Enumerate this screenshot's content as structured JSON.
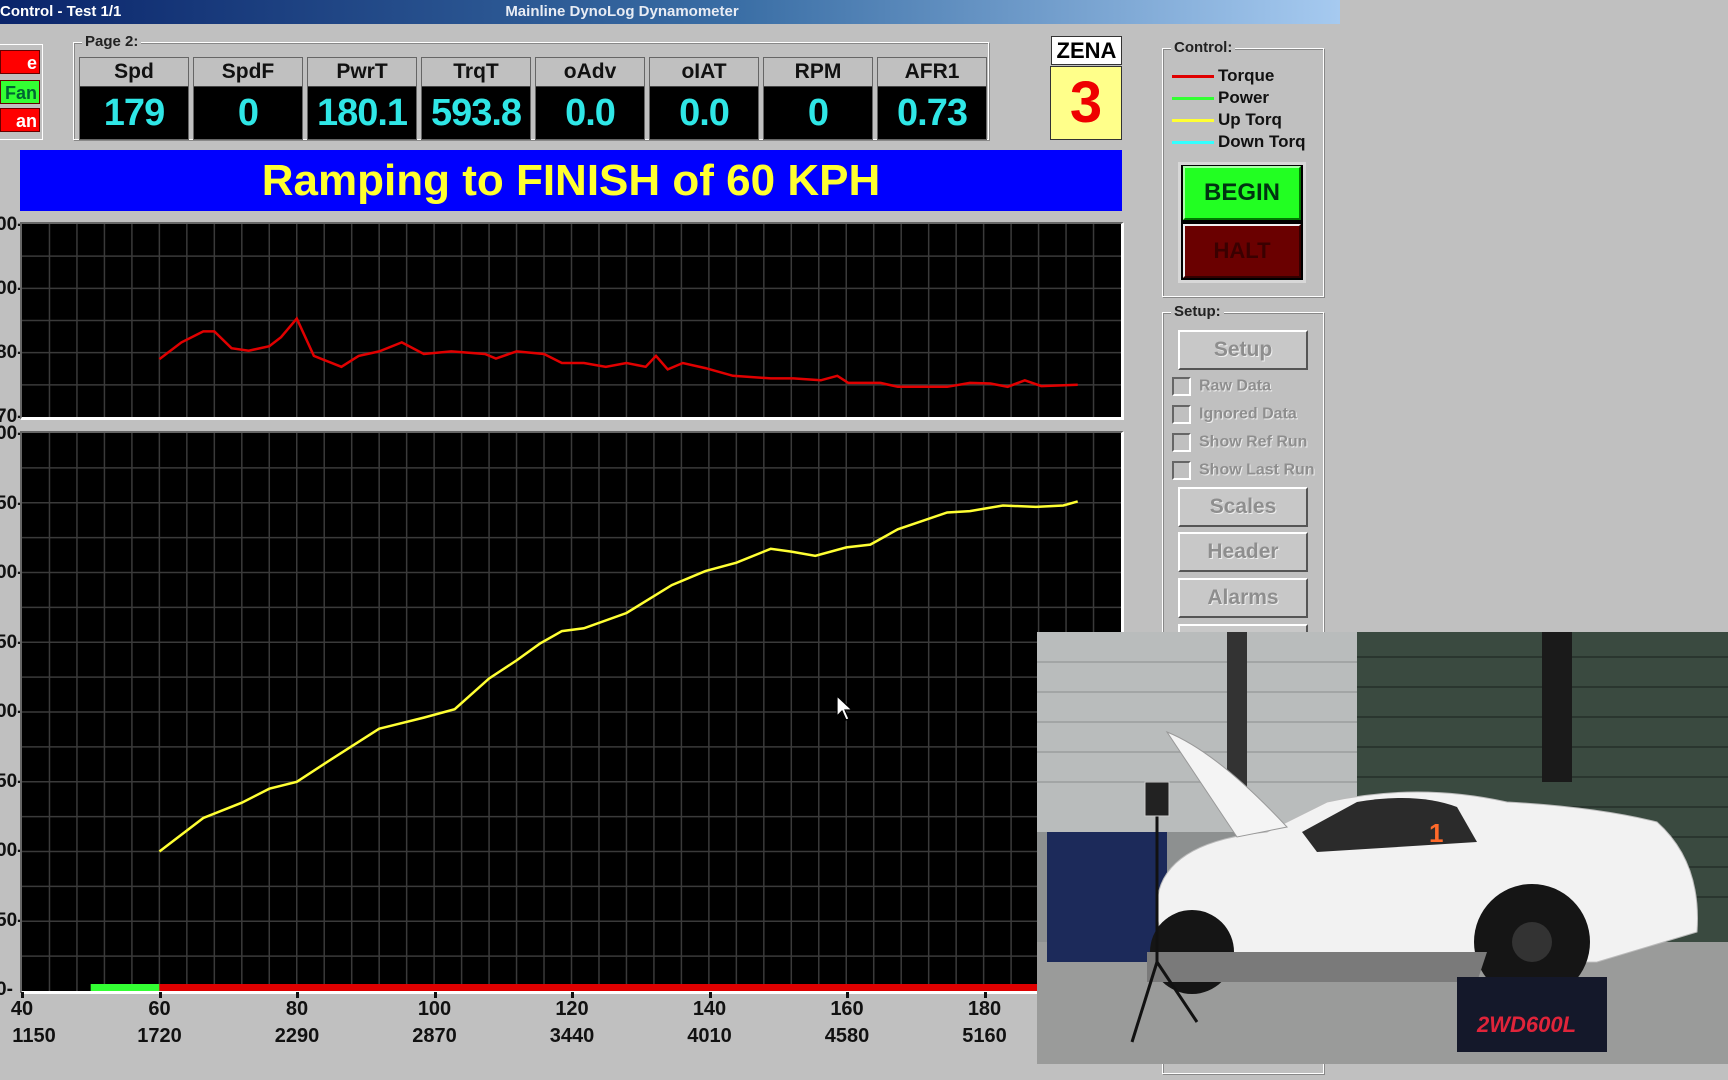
{
  "window": {
    "title_left": "Control - Test 1/1",
    "title_center": "Mainline DynoLog Dynamometer"
  },
  "indicators": [
    {
      "label": "e",
      "color": "#ff0000"
    },
    {
      "label": "Fan",
      "color": "#33ff33"
    },
    {
      "label": "an",
      "color": "#ff0000"
    }
  ],
  "page_group": {
    "label": "Page 2:",
    "gauges": [
      {
        "name": "Spd",
        "value": "179"
      },
      {
        "name": "SpdF",
        "value": "0"
      },
      {
        "name": "PwrT",
        "value": "180.1"
      },
      {
        "name": "TrqT",
        "value": "593.8"
      },
      {
        "name": "oAdv",
        "value": "0.0"
      },
      {
        "name": "oIAT",
        "value": "0.0"
      },
      {
        "name": "RPM",
        "value": "0"
      },
      {
        "name": "AFR1",
        "value": "0.73"
      }
    ]
  },
  "zena": {
    "label": "ZENA",
    "value": "3"
  },
  "status_banner": "Ramping to FINISH of 60 KPH",
  "control": {
    "label": "Control:",
    "legend": [
      {
        "name": "Torque",
        "color": "#e00000"
      },
      {
        "name": "Power",
        "color": "#33ff33"
      },
      {
        "name": "Up Torq",
        "color": "#ffff33"
      },
      {
        "name": "Down Torq",
        "color": "#33ffff"
      }
    ],
    "begin_label": "BEGIN",
    "halt_label": "HALT"
  },
  "setup": {
    "label": "Setup:",
    "setup_button": "Setup",
    "checkboxes": [
      {
        "label": "Raw Data",
        "checked": false
      },
      {
        "label": "Ignored Data",
        "checked": false
      },
      {
        "label": "Show Ref Run",
        "checked": false
      },
      {
        "label": "Show Last Run",
        "checked": false
      }
    ],
    "buttons": [
      "Scales",
      "Header",
      "Alarms"
    ]
  },
  "camera_feed": {
    "dyno_lettering": "2WD600L",
    "car_number": "1"
  },
  "chart_data": [
    {
      "type": "line",
      "xlim": [
        40,
        200
      ],
      "ylim": [
        70,
        100
      ],
      "ytick_labels": [
        "00-",
        "00-",
        "80-",
        "70-"
      ],
      "grid": true,
      "series": [
        {
          "name": "Torque",
          "color": "#e00000",
          "x": [
            60,
            63.2,
            66.4,
            68,
            70.5,
            73,
            76,
            77.7,
            80,
            82.5,
            86.5,
            89,
            92,
            95.3,
            98.5,
            102.5,
            107.4,
            109,
            112,
            116,
            118.6,
            121.8,
            125,
            128,
            130.8,
            132.3,
            134,
            136.2,
            139.5,
            143.5,
            149,
            152.3,
            156.3,
            158.7,
            160.3,
            165,
            167.5,
            174.7,
            178,
            181,
            183.5,
            186,
            188.4,
            193.7
          ],
          "y": [
            79.0,
            81.6,
            83.3,
            83.3,
            80.7,
            80.3,
            81.0,
            82.4,
            85.3,
            79.5,
            77.8,
            79.5,
            80.2,
            81.6,
            79.8,
            80.2,
            79.8,
            79.1,
            80.2,
            79.8,
            78.4,
            78.4,
            77.8,
            78.4,
            77.8,
            79.5,
            77.4,
            78.4,
            77.6,
            76.4,
            76.0,
            76.0,
            75.7,
            76.4,
            75.3,
            75.3,
            74.7,
            74.7,
            75.3,
            75.2,
            74.7,
            75.7,
            74.8,
            75.0
          ]
        }
      ]
    },
    {
      "type": "line",
      "xlim": [
        40,
        200
      ],
      "ylim": [
        0,
        400
      ],
      "ytick_labels": [
        "00-",
        "50-",
        "00-",
        "50-",
        "00-",
        "50-",
        "00-",
        "50-",
        "0-"
      ],
      "xticks": [
        40,
        60,
        80,
        100,
        120,
        140,
        160,
        180
      ],
      "xtick_labels_rpm": [
        "1150",
        "1720",
        "2290",
        "2870",
        "3440",
        "4010",
        "4580",
        "5160"
      ],
      "grid": true,
      "series": [
        {
          "name": "Up Torq",
          "color": "#ffff33",
          "x": [
            60,
            66.4,
            72,
            76,
            80,
            85,
            92,
            98.5,
            103,
            108,
            112,
            115.4,
            118.6,
            121.8,
            128,
            134.6,
            139.5,
            144,
            149,
            152,
            155.5,
            160,
            163.5,
            167.5,
            174.7,
            178,
            182.8,
            187.6,
            191.6,
            193.7
          ],
          "y": [
            100,
            124,
            135,
            145,
            150,
            166,
            188,
            196,
            202,
            224,
            237,
            249,
            258,
            260,
            271,
            291,
            301,
            307,
            317,
            315,
            312,
            318,
            320,
            331,
            343,
            344,
            348,
            347,
            348,
            351
          ]
        }
      ],
      "progress_bar": {
        "green_range": [
          50,
          60
        ],
        "red_range": [
          60,
          200
        ]
      }
    }
  ]
}
